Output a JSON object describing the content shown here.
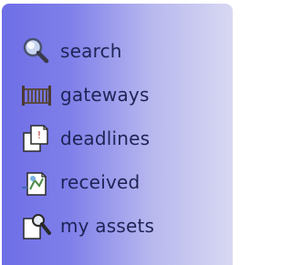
{
  "menu": {
    "items": [
      {
        "label": "search",
        "icon": "magnifier-icon"
      },
      {
        "label": "gateways",
        "icon": "gate-icon"
      },
      {
        "label": "deadlines",
        "icon": "deadline-document-icon"
      },
      {
        "label": "received",
        "icon": "received-document-icon"
      },
      {
        "label": "my assets",
        "icon": "assets-document-icon"
      }
    ]
  },
  "colors": {
    "panel_gradient_start": "#6e6ee6",
    "panel_gradient_end": "#d8d8f2",
    "label_text": "#1e2455"
  }
}
